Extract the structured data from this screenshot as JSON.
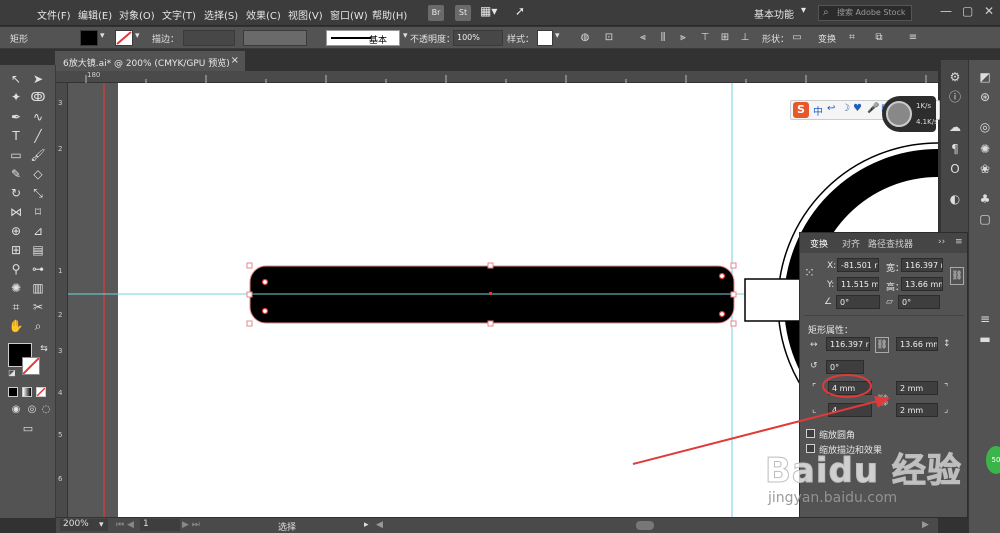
{
  "menu": [
    "文件(F)",
    "编辑(E)",
    "对象(O)",
    "文字(T)",
    "选择(S)",
    "效果(C)",
    "视图(V)",
    "窗口(W)",
    "帮助(H)"
  ],
  "app_icons": [
    "Br",
    "St"
  ],
  "workspace": "基本功能",
  "search_placeholder": "搜索 Adobe Stock",
  "control": {
    "object_label": "矩形",
    "stroke_label": "描边：",
    "brush_label": "基本",
    "opacity_label": "不透明度：",
    "opacity_value": "100%",
    "style_label": "样式：",
    "shape_label": "形状：",
    "transform_label": "变换"
  },
  "document_tab": "6放大镜.ai* @ 200% (CMYK/GPU 预览)",
  "ruler": {
    "top": [
      "180",
      "",
      "",
      "",
      "",
      "",
      "",
      "",
      "",
      "",
      "",
      "",
      ""
    ],
    "left": [
      "3",
      "2",
      "1",
      "1",
      "2",
      "3",
      "4",
      "5",
      "6"
    ]
  },
  "status": {
    "zoom": "200%",
    "page": "1",
    "tool": "选择"
  },
  "transform_panel": {
    "tabs": [
      "变换",
      "对齐",
      "路径查找器"
    ],
    "x_label": "X:",
    "x_value": "-81.501 r",
    "y_label": "Y:",
    "y_value": "11.515 mm",
    "w_label": "宽：",
    "w_value": "116.397 r",
    "h_label": "高：",
    "h_value": "13.66 mm",
    "angle_value": "0°",
    "shear_value": "0°",
    "rect_props_label": "矩形属性：",
    "rect_w": "116.397 r",
    "rect_h": "13.66 mm",
    "rotate_value": "0°",
    "radius_tl": "4 mm",
    "radius_tr": "2 mm",
    "radius_bl": "4",
    "radius_br": "2 mm",
    "scale_corners": "缩放圆角",
    "scale_strokes": "缩放描边和效果"
  },
  "ime": {
    "items": [
      "中",
      "↩",
      "☽",
      "♥",
      "🎤",
      "▦",
      "👕",
      "🔧"
    ]
  },
  "network": {
    "up": "1K/s",
    "down": "4.1K/s"
  },
  "watermark": {
    "logo": "Baidu 经验",
    "url": "jingyan.baidu.com"
  },
  "colors": {
    "accent_red": "#e03a3a",
    "guide": "#6fd3e0",
    "artboard": "#ffffff"
  }
}
